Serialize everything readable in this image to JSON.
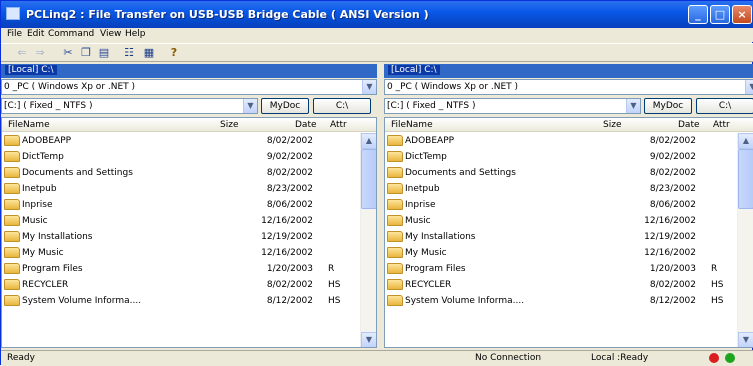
{
  "window": {
    "title": "PCLinq2 : File Transfer on USB-USB Bridge Cable ( ANSI Version )"
  },
  "menu": [
    "File",
    "Edit",
    "Command",
    "View",
    "Help"
  ],
  "toolbar": {
    "icons": [
      "back-icon",
      "forward-icon",
      "cut-icon",
      "copy-icon",
      "paste-icon",
      "list-view-icon",
      "detail-view-icon",
      "help-icon"
    ]
  },
  "panes": [
    {
      "header": "[Local] C:\\",
      "pc_combo": "0        _PC  ( Windows Xp or .NET  )",
      "drive_combo": "[C:]  ( Fixed _ NTFS )",
      "mydoc_label": "MyDoc",
      "root_label": "C:\\",
      "columns": {
        "name": "FileName",
        "size": "Size",
        "date": "Date",
        "attr": "Attr"
      },
      "rows": [
        {
          "name": "ADOBEAPP",
          "date": "8/02/2002",
          "attr": ""
        },
        {
          "name": "DictTemp",
          "date": "9/02/2002",
          "attr": ""
        },
        {
          "name": "Documents and Settings",
          "date": "8/02/2002",
          "attr": ""
        },
        {
          "name": "Inetpub",
          "date": "8/23/2002",
          "attr": ""
        },
        {
          "name": "Inprise",
          "date": "8/06/2002",
          "attr": ""
        },
        {
          "name": "Music",
          "date": "12/16/2002",
          "attr": ""
        },
        {
          "name": "My Installations",
          "date": "12/19/2002",
          "attr": ""
        },
        {
          "name": "My Music",
          "date": "12/16/2002",
          "attr": ""
        },
        {
          "name": "Program Files",
          "date": "1/20/2003",
          "attr": "R"
        },
        {
          "name": "RECYCLER",
          "date": "8/02/2002",
          "attr": "HS"
        },
        {
          "name": "System Volume Informa....",
          "date": "8/12/2002",
          "attr": "HS"
        }
      ]
    },
    {
      "header": "[Local] C:\\",
      "pc_combo": "0        _PC  ( Windows Xp or .NET  )",
      "drive_combo": "[C:]  ( Fixed _ NTFS )",
      "mydoc_label": "MyDoc",
      "root_label": "C:\\",
      "columns": {
        "name": "FileName",
        "size": "Size",
        "date": "Date",
        "attr": "Attr"
      },
      "rows": [
        {
          "name": "ADOBEAPP",
          "date": "8/02/2002",
          "attr": ""
        },
        {
          "name": "DictTemp",
          "date": "9/02/2002",
          "attr": ""
        },
        {
          "name": "Documents and Settings",
          "date": "8/02/2002",
          "attr": ""
        },
        {
          "name": "Inetpub",
          "date": "8/23/2002",
          "attr": ""
        },
        {
          "name": "Inprise",
          "date": "8/06/2002",
          "attr": ""
        },
        {
          "name": "Music",
          "date": "12/16/2002",
          "attr": ""
        },
        {
          "name": "My Installations",
          "date": "12/19/2002",
          "attr": ""
        },
        {
          "name": "My Music",
          "date": "12/16/2002",
          "attr": ""
        },
        {
          "name": "Program Files",
          "date": "1/20/2003",
          "attr": "R"
        },
        {
          "name": "RECYCLER",
          "date": "8/02/2002",
          "attr": "HS"
        },
        {
          "name": "System Volume Informa....",
          "date": "8/12/2002",
          "attr": "HS"
        }
      ]
    }
  ],
  "status": {
    "left": "Ready",
    "connection": "No Connection",
    "local": "Local :Ready",
    "indicator_colors": [
      "#d81e1e",
      "#1ea51e"
    ]
  },
  "colors": {
    "titlebar": "#0a58e8",
    "pane_header": "#3169c6",
    "folder": "#e8b73d"
  }
}
